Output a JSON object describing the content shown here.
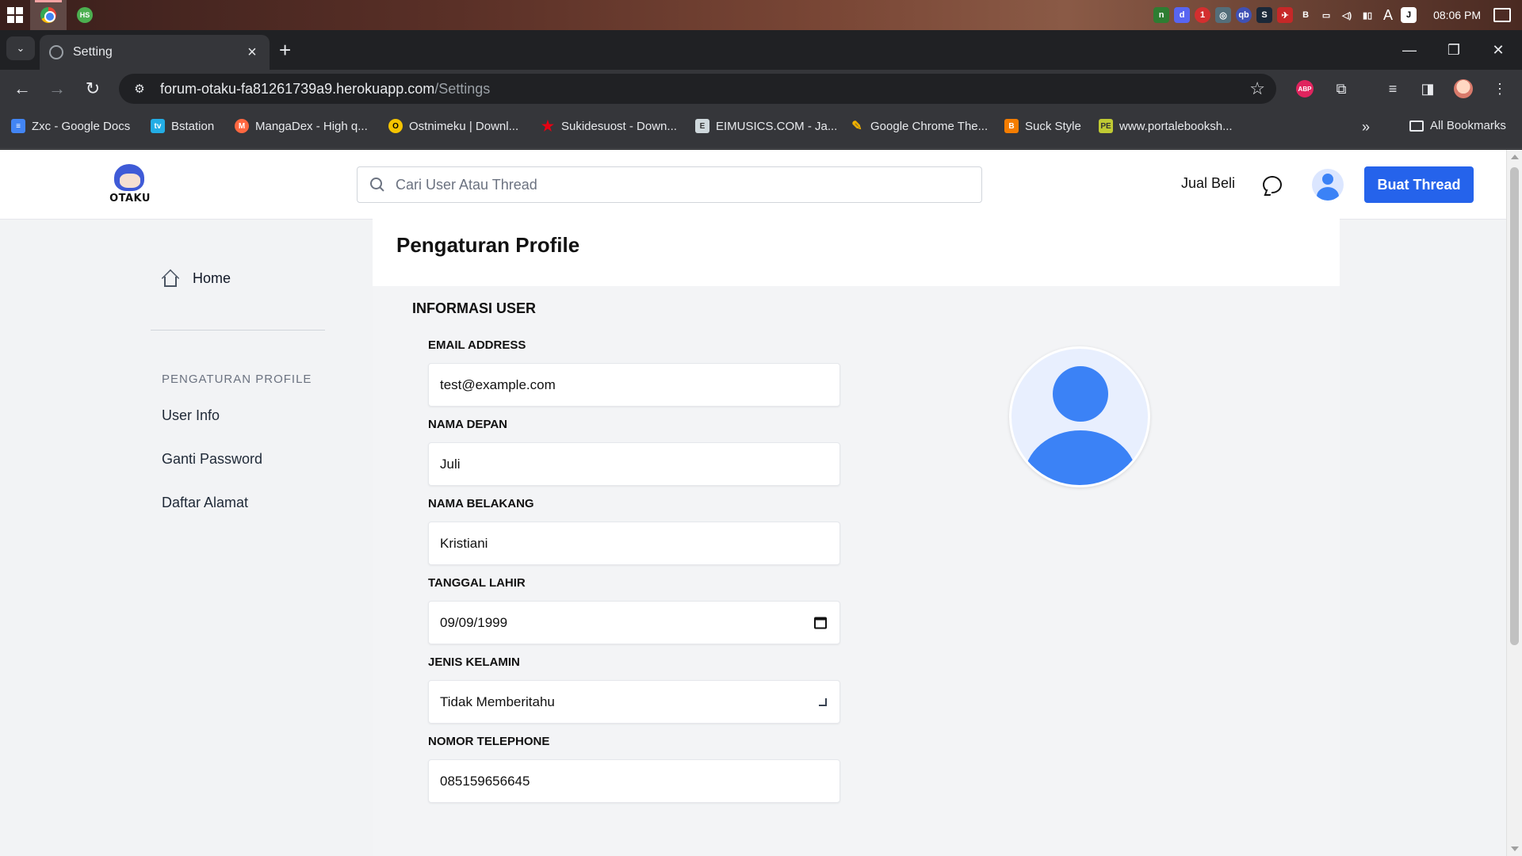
{
  "taskbar": {
    "clock": "08:06 PM"
  },
  "browser": {
    "tab_title": "Setting",
    "url_host": "forum-otaku-fa81261739a9.herokuapp.com",
    "url_path": "/Settings",
    "bookmarks": [
      {
        "label": "Zxc - Google Docs",
        "icon": "docs-icon",
        "color": "#4285f4"
      },
      {
        "label": "Bstation",
        "icon": "bstation-icon",
        "color": "#23ade5"
      },
      {
        "label": "MangaDex - High q...",
        "icon": "mangadex-icon",
        "color": "#ff6740"
      },
      {
        "label": "Ostnimeku | Downl...",
        "icon": "ostnimeku-icon",
        "color": "#f5c400"
      },
      {
        "label": "Sukidesuost - Down...",
        "icon": "sukidesuost-icon",
        "color": "#e60012"
      },
      {
        "label": "EIMUSICS.COM - Ja...",
        "icon": "eimusics-icon",
        "color": "#cfd8dc"
      },
      {
        "label": "Google Chrome The...",
        "icon": "chrome-theme-icon",
        "color": "#f4b400"
      },
      {
        "label": "Suck Style",
        "icon": "blogger-icon",
        "color": "#f57d00"
      },
      {
        "label": "www.portalebooksh...",
        "icon": "portalebook-icon",
        "color": "#c0ca33"
      }
    ],
    "all_bookmarks": "All Bookmarks"
  },
  "site": {
    "logo_text": "OTAKU",
    "search_placeholder": "Cari User Atau Thread",
    "nav_jual_beli": "Jual Beli",
    "create_thread": "Buat Thread",
    "accent": "#2563eb"
  },
  "sidebar": {
    "home": "Home",
    "section": "PENGATURAN PROFILE",
    "links": [
      "User Info",
      "Ganti Password",
      "Daftar Alamat"
    ]
  },
  "main": {
    "title": "Pengaturan Profile",
    "section": "INFORMASI USER",
    "fields": [
      {
        "label": "EMAIL ADDRESS",
        "value": "test@example.com"
      },
      {
        "label": "NAMA DEPAN",
        "value": "Juli"
      },
      {
        "label": "NAMA BELAKANG",
        "value": "Kristiani"
      },
      {
        "label": "TANGGAL LAHIR",
        "value": "09/09/1999"
      },
      {
        "label": "JENIS KELAMIN",
        "value": "Tidak Memberitahu"
      },
      {
        "label": "NOMOR TELEPHONE",
        "value": "085159656645"
      }
    ]
  }
}
